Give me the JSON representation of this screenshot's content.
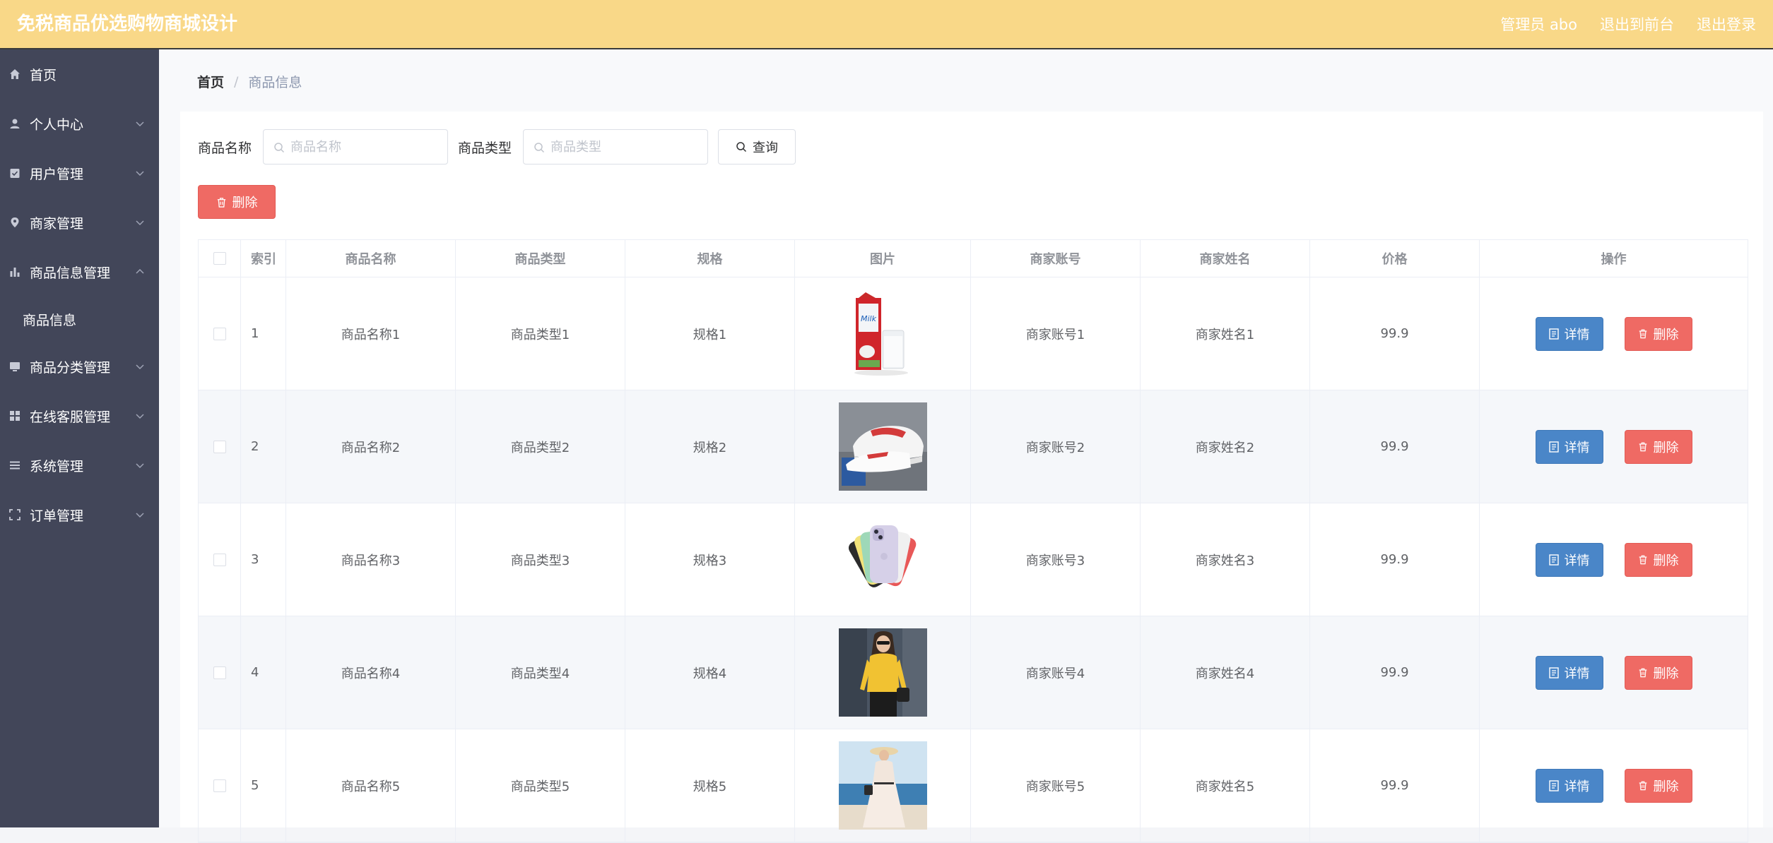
{
  "header": {
    "title": "免税商品优选购物商城设计",
    "admin_label": "管理员 abo",
    "to_front_label": "退出到前台",
    "logout_label": "退出登录"
  },
  "sidebar": {
    "items": [
      {
        "label": "首页",
        "icon": "home-icon"
      },
      {
        "label": "个人中心",
        "icon": "person-icon"
      },
      {
        "label": "用户管理",
        "icon": "user-check-icon"
      },
      {
        "label": "商家管理",
        "icon": "pin-icon"
      },
      {
        "label": "商品信息管理",
        "icon": "bar-chart-icon"
      },
      {
        "label": "商品信息"
      },
      {
        "label": "商品分类管理",
        "icon": "monitor-icon"
      },
      {
        "label": "在线客服管理",
        "icon": "grid-icon"
      },
      {
        "label": "系统管理",
        "icon": "list-icon"
      },
      {
        "label": "订单管理",
        "icon": "frame-icon"
      }
    ]
  },
  "breadcrumb": {
    "home": "首页",
    "separator": "/",
    "current": "商品信息"
  },
  "search": {
    "name_label": "商品名称",
    "name_placeholder": "商品名称",
    "type_label": "商品类型",
    "type_placeholder": "商品类型",
    "query_label": "查询"
  },
  "toolbar": {
    "delete_label": "删除"
  },
  "table": {
    "columns": [
      "索引",
      "商品名称",
      "商品类型",
      "规格",
      "图片",
      "商家账号",
      "商家姓名",
      "价格",
      "操作"
    ],
    "detail_label": "详情",
    "delete_label": "删除",
    "rows": [
      {
        "index": "1",
        "name": "商品名称1",
        "type": "商品类型1",
        "spec": "规格1",
        "image": "milk-carton-photo",
        "account": "商家账号1",
        "merchant": "商家姓名1",
        "price": "99.9"
      },
      {
        "index": "2",
        "name": "商品名称2",
        "type": "商品类型2",
        "spec": "规格2",
        "image": "sneakers-photo",
        "account": "商家账号2",
        "merchant": "商家姓名2",
        "price": "99.9"
      },
      {
        "index": "3",
        "name": "商品名称3",
        "type": "商品类型3",
        "spec": "规格3",
        "image": "phones-photo",
        "account": "商家账号3",
        "merchant": "商家姓名3",
        "price": "99.9"
      },
      {
        "index": "4",
        "name": "商品名称4",
        "type": "商品类型4",
        "spec": "规格4",
        "image": "yellow-top-photo",
        "account": "商家账号4",
        "merchant": "商家姓名4",
        "price": "99.9"
      },
      {
        "index": "5",
        "name": "商品名称5",
        "type": "商品类型5",
        "spec": "规格5",
        "image": "dress-photo",
        "account": "商家账号5",
        "merchant": "商家姓名5",
        "price": "99.9"
      }
    ]
  },
  "colors": {
    "topbar": "#f9d888",
    "sidebar": "#424659",
    "detail_button": "#4a86c8",
    "delete_button": "#ef6a64"
  }
}
